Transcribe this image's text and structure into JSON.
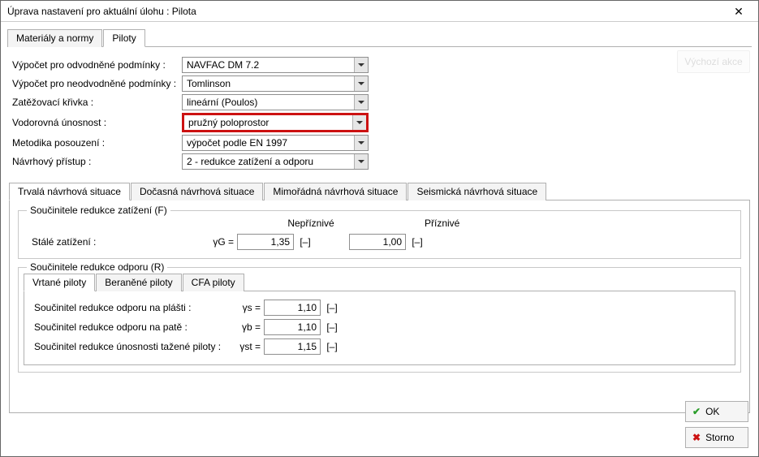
{
  "title": "Úprava nastavení pro aktuální úlohu : Pilota",
  "outerTabs": {
    "t0": "Materiály a normy",
    "t1": "Piloty"
  },
  "ghost_button": "Výchozí akce",
  "form": {
    "l0": "Výpočet pro odvodněné podmínky :",
    "l1": "Výpočet pro neodvodněné podmínky :",
    "l2": "Zatěžovací křivka :",
    "l3": "Vodorovná únosnost :",
    "l4": "Metodika posouzení :",
    "l5": "Návrhový přístup :",
    "v0": "NAVFAC DM 7.2",
    "v1": "Tomlinson",
    "v2": "lineární (Poulos)",
    "v3": "pružný poloprostor",
    "v4": "výpočet podle EN 1997",
    "v5": "2 - redukce zatížení a odporu"
  },
  "situ": {
    "t0": "Trvalá návrhová situace",
    "t1": "Dočasná návrhová situace",
    "t2": "Mimořádná návrhová situace",
    "t3": "Seismická návrhová situace"
  },
  "group1": {
    "legend": "Součinitele redukce zatížení (F)",
    "h0": "Nepříznivé",
    "h1": "Příznivé",
    "row_label": "Stálé zatížení :",
    "sym": "γG =",
    "val0": "1,35",
    "val1": "1,00",
    "unit": "[–]"
  },
  "group2": {
    "legend": "Součinitele redukce odporu (R)",
    "tabs": {
      "t0": "Vrtané piloty",
      "t1": "Beraněné piloty",
      "t2": "CFA piloty"
    },
    "r0l": "Součinitel redukce odporu na plášti :",
    "r0s": "γs =",
    "r0v": "1,10",
    "r1l": "Součinitel redukce odporu na patě :",
    "r1s": "γb =",
    "r1v": "1,10",
    "r2l": "Součinitel redukce únosnosti tažené piloty :",
    "r2s": "γst =",
    "r2v": "1,15",
    "unit": "[–]"
  },
  "buttons": {
    "ok": "OK",
    "storno": "Storno"
  }
}
